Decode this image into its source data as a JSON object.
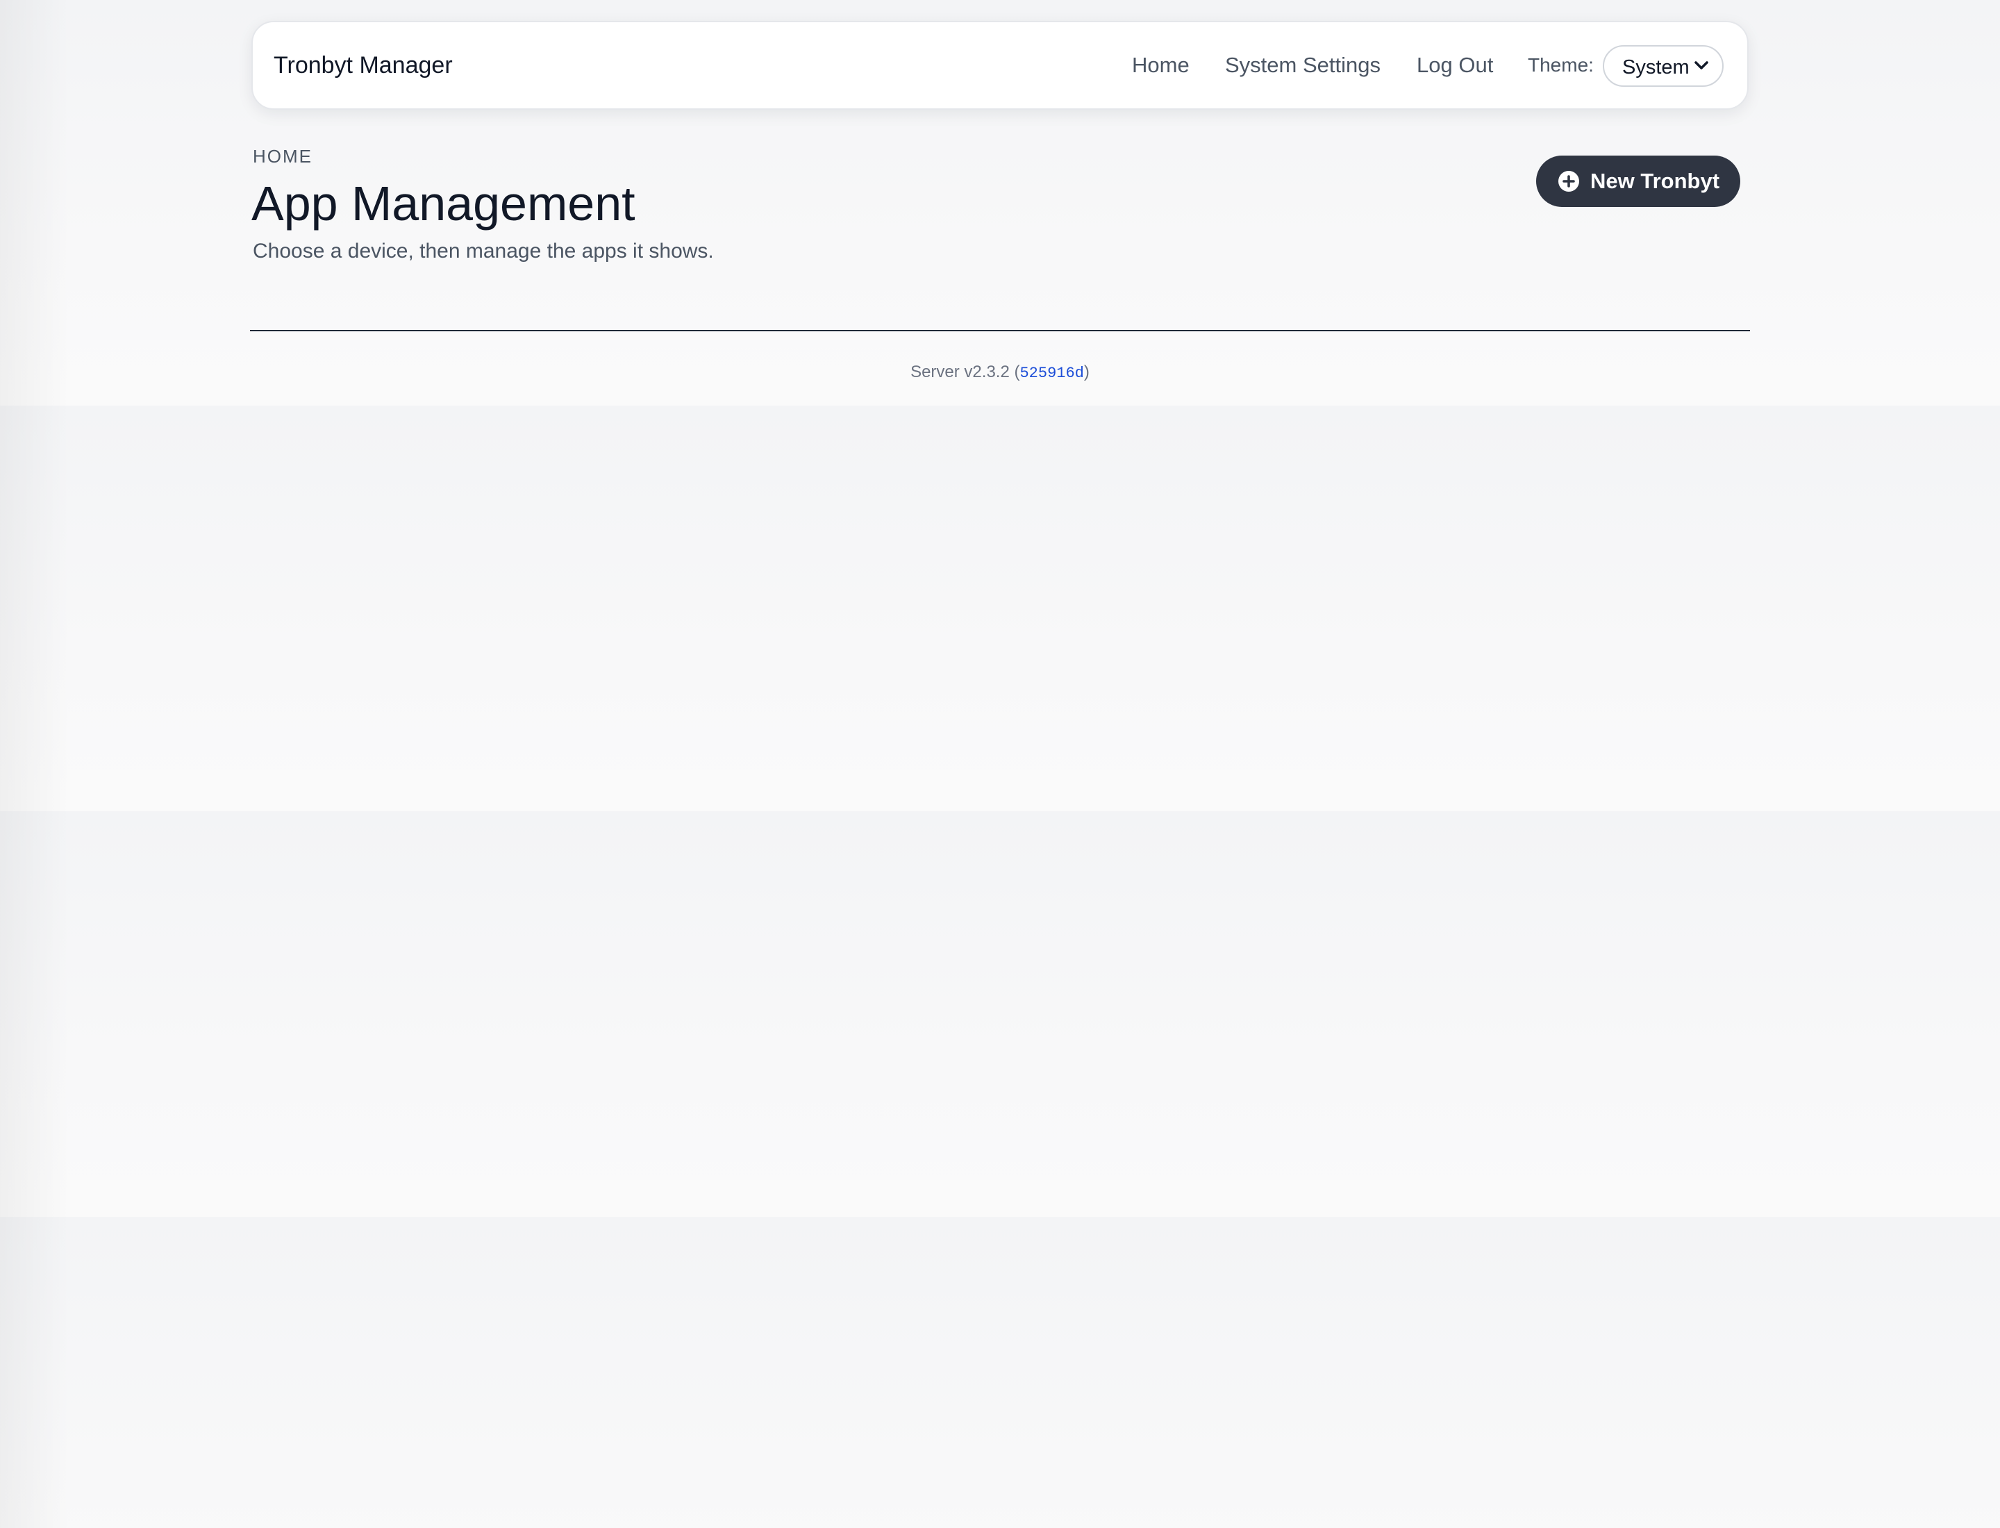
{
  "navbar": {
    "brand": "Tronbyt Manager",
    "links": {
      "home": "Home",
      "system_settings": "System Settings",
      "log_out": "Log Out"
    },
    "theme": {
      "label": "Theme:",
      "selected": "System"
    }
  },
  "header": {
    "breadcrumb": "HOME",
    "title": "App Management",
    "subtitle": "Choose a device, then manage the apps it shows.",
    "new_button_label": "New Tronbyt",
    "new_button_icon": "plus-circle-icon"
  },
  "footer": {
    "version_prefix": "Server v2.3.2 (",
    "commit": "525916d",
    "version_suffix": ")"
  },
  "colors": {
    "button_bg": "#2f3542",
    "link_blue": "#1d4ed8",
    "page_bg": "#f6f7f9"
  }
}
